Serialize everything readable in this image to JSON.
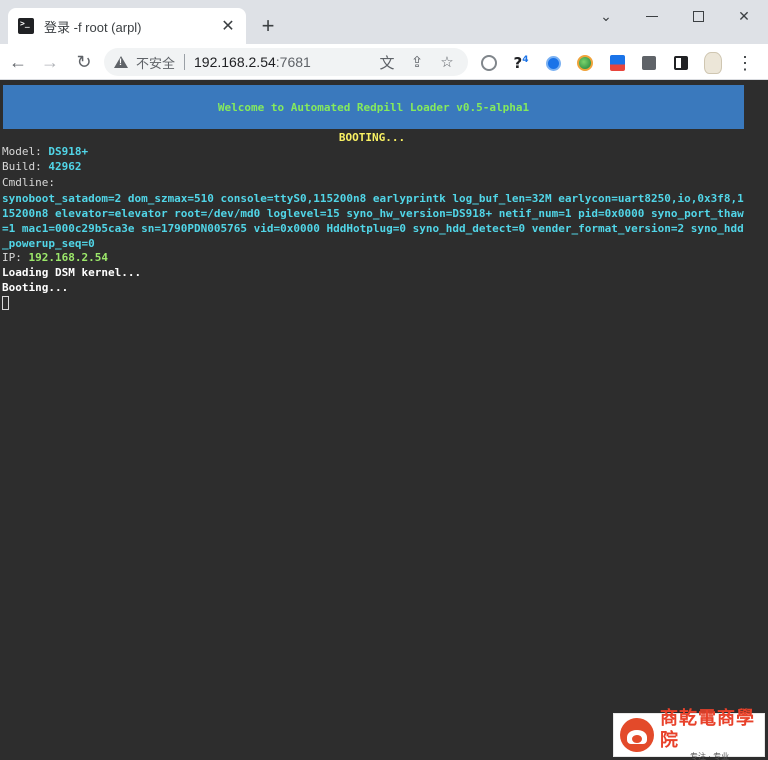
{
  "browser": {
    "tab": {
      "title": "登录 -f root (arpl)",
      "close_glyph": "✕"
    },
    "new_tab_glyph": "+",
    "window_controls": {
      "chevron": "⌄",
      "close": "✕"
    },
    "toolbar": {
      "back": "←",
      "forward": "→",
      "reload": "↻"
    },
    "omnibox": {
      "security_label": "不安全",
      "url_host": "192.168.2.54",
      "url_port": ":7681",
      "translate_icon": "文",
      "share_icon": "⇪",
      "bookmark_icon": "☆"
    },
    "extensions": {
      "ext2_label": "?",
      "ext2_badge": "4",
      "menu": "⋮"
    }
  },
  "terminal": {
    "banner": "Welcome to Automated Redpill Loader v0.5-alpha1",
    "status_header": "BOOTING...",
    "model_label": "Model: ",
    "model_value": "DS918+",
    "build_label": "Build: ",
    "build_value": "42962",
    "cmdline_label": "Cmdline:",
    "cmdline_value": "synoboot_satadom=2 dom_szmax=510 console=ttyS0,115200n8 earlyprintk log_buf_len=32M earlycon=uart8250,io,0x3f8,115200n8 elevator=elevator root=/dev/md0 loglevel=15 syno_hw_version=DS918+ netif_num=1 pid=0x0000 syno_port_thaw=1 mac1=000c29b5ca3e sn=1790PDN005765 vid=0x0000 HddHotplug=0 syno_hdd_detect=0 vender_format_version=2 syno_hdd_powerup_seq=0",
    "ip_label": "IP: ",
    "ip_value": "192.168.2.54",
    "line_loading": "Loading DSM kernel...",
    "line_booting": "Booting..."
  },
  "watermark": {
    "main": "商乾電商學院",
    "sub": "专注 · 专业"
  }
}
